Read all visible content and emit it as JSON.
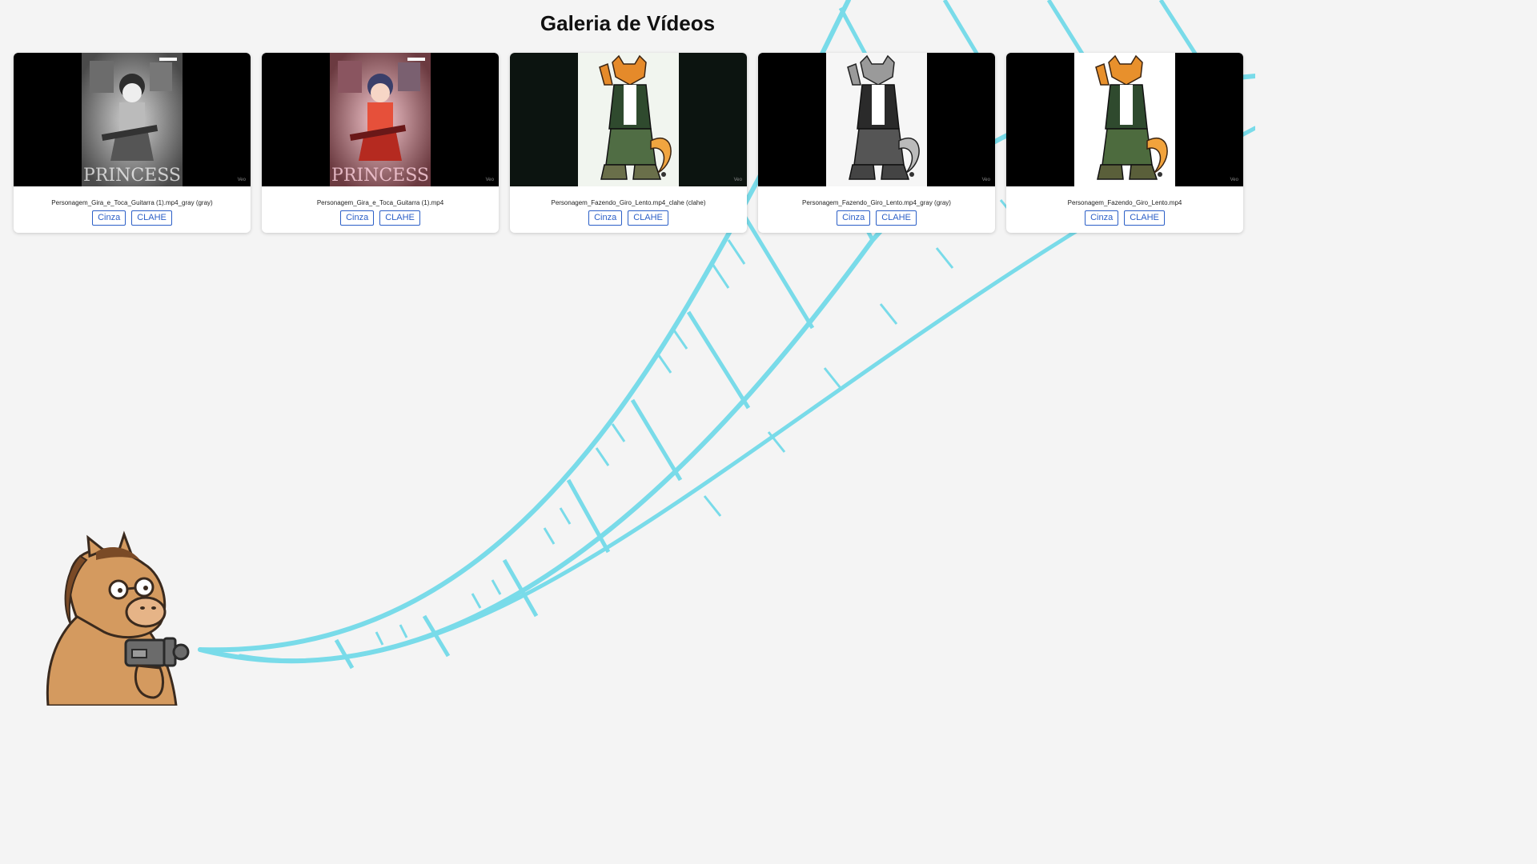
{
  "page": {
    "title": "Galeria de Vídeos"
  },
  "videos": [
    {
      "caption": "Personagem_Gira_e_Toca_Guitarra (1).mp4_gray (gray)",
      "gray_label": "Cinza",
      "clahe_label": "CLAHE",
      "watermark": "Veo",
      "thumbnail": "guitar-girl-grayscale"
    },
    {
      "caption": "Personagem_Gira_e_Toca_Guitarra (1).mp4",
      "gray_label": "Cinza",
      "clahe_label": "CLAHE",
      "watermark": "Veo",
      "thumbnail": "guitar-girl-color"
    },
    {
      "caption": "Personagem_Fazendo_Giro_Lento.mp4_clahe (clahe)",
      "gray_label": "Cinza",
      "clahe_label": "CLAHE",
      "watermark": "Veo",
      "thumbnail": "fox-character-clahe"
    },
    {
      "caption": "Personagem_Fazendo_Giro_Lento.mp4_gray (gray)",
      "gray_label": "Cinza",
      "clahe_label": "CLAHE",
      "watermark": "Veo",
      "thumbnail": "fox-character-grayscale"
    },
    {
      "caption": "Personagem_Fazendo_Giro_Lento.mp4",
      "gray_label": "Cinza",
      "clahe_label": "CLAHE",
      "watermark": "Veo",
      "thumbnail": "fox-character-color"
    }
  ],
  "poster_lettering": "PRINCESS",
  "colors": {
    "background": "#f4f4f4",
    "film_strip": "#79dbe9",
    "button_accent": "#2b5fc7",
    "mascot_body": "#d49a5f"
  },
  "decorations": {
    "mascot": "horse-mascot-with-camera",
    "film": "film-strip"
  }
}
